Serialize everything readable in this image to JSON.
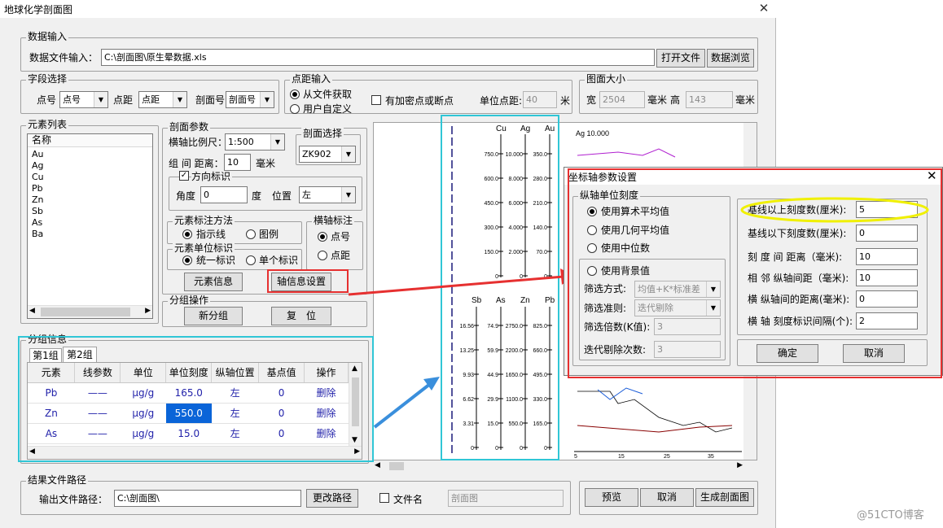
{
  "window": {
    "title": "地球化学剖面图",
    "close_glyph": "✕"
  },
  "data_input": {
    "group_title": "数据输入",
    "file_label": "数据文件输入：",
    "file_path": "C:\\剖面图\\原生晕数据.xls",
    "open_button": "打开文件",
    "browse_button": "数据浏览"
  },
  "field_select": {
    "group_title": "字段选择",
    "point_label": "点号",
    "point_value": "点号",
    "distance_label": "点距",
    "distance_value": "点距",
    "section_label": "剖面号",
    "section_value": "剖面号"
  },
  "point_distance": {
    "group_title": "点距输入",
    "from_file": "从文件获取",
    "custom": "用户自定义",
    "encrypt_label": "有加密点或断点",
    "unit_label": "单位点距:",
    "unit_value": "40",
    "unit_suffix": "米"
  },
  "map_size": {
    "group_title": "图面大小",
    "width_label": "宽",
    "width_value": "2504",
    "mm_label": "毫米",
    "height_label": "高",
    "height_value": "143",
    "mm_label2": "毫米"
  },
  "elements": {
    "group_title": "元素列表",
    "header": "名称",
    "items": [
      "Au",
      "Ag",
      "Cu",
      "Pb",
      "Zn",
      "Sb",
      "As",
      "Ba"
    ]
  },
  "section_params": {
    "group_title": "剖面参数",
    "scale_label": "横轴比例尺：",
    "scale_value": "1:500",
    "group_dist_label": "组 间 距离：",
    "group_dist_value": "10",
    "group_dist_unit": "毫米",
    "section_select_title": "剖面选择",
    "section_select_value": "ZK902",
    "direction_label": "方向标识",
    "direction_check": "✓",
    "angle_label": "角度",
    "angle_value": "0",
    "degree_label": "度",
    "position_label": "位置",
    "position_value": "左"
  },
  "element_mark": {
    "group_title": "元素标注方法",
    "opt1": "指示线",
    "opt2": "图例"
  },
  "element_unit": {
    "group_title": "元素单位标识",
    "opt1": "统一标识",
    "opt2": "单个标识"
  },
  "haxis_mark": {
    "group_title": "横轴标注",
    "opt1": "点号",
    "opt2": "点距"
  },
  "buttons": {
    "element_info": "元素信息",
    "axis_info": "轴信息设置"
  },
  "group_ops": {
    "group_title": "分组操作",
    "new_group": "新分组",
    "reset": "复　位"
  },
  "group_info": {
    "group_title": "分组信息",
    "tab1": "第1组",
    "tab2": "第2组",
    "columns": [
      "元素",
      "线参数",
      "单位",
      "单位刻度",
      "纵轴位置",
      "基点值",
      "操作"
    ],
    "rows": [
      {
        "element": "Pb",
        "line": "——",
        "unit": "μg/g",
        "scale": "165.0",
        "pos": "左",
        "base": "0",
        "op": "删除"
      },
      {
        "element": "Zn",
        "line": "——",
        "unit": "μg/g",
        "scale": "550.0",
        "pos": "左",
        "base": "0",
        "op": "删除"
      },
      {
        "element": "As",
        "line": "——",
        "unit": "μg/g",
        "scale": "15.0",
        "pos": "左",
        "base": "0",
        "op": "删除"
      }
    ]
  },
  "result_path": {
    "group_title": "结果文件路径",
    "output_label": "输出文件路径：",
    "output_value": "C:\\剖面图\\",
    "change_button": "更改路径",
    "filename_label": "文件名",
    "filename_value": "剖面图"
  },
  "bottom_buttons": {
    "preview": "预览",
    "cancel": "取消",
    "generate": "生成剖面图"
  },
  "preview_chart": {
    "top_labels": [
      "Cu",
      "Ag",
      "Au"
    ],
    "top_col1": [
      "750.0",
      "600.0",
      "450.0",
      "300.0",
      "150.0",
      "0"
    ],
    "top_col2": [
      "10.000",
      "8.000",
      "6.000",
      "4.000",
      "2.000",
      "0"
    ],
    "top_col3": [
      "350.0",
      "280.0",
      "210.0",
      "140.0",
      "70.0",
      "0"
    ],
    "bottom_labels": [
      "Sb",
      "As",
      "Zn",
      "Pb"
    ],
    "bottom_col1": [
      "16.56",
      "13.25",
      "9.93",
      "6.62",
      "3.31",
      "0"
    ],
    "bottom_col2": [
      "74.9",
      "59.9",
      "44.9",
      "29.9",
      "15.0",
      "0"
    ],
    "bottom_col3": [
      "2750.0",
      "2200.0",
      "1650.0",
      "1100.0",
      "550.0",
      "0"
    ],
    "bottom_col4": [
      "825.0",
      "660.0",
      "495.0",
      "330.0",
      "165.0",
      "0"
    ],
    "x_labels": [
      "5",
      "15",
      "25",
      "35"
    ],
    "small_label": "Ag 10.000"
  },
  "dialog": {
    "title": "坐标轴参数设置",
    "vunit_title": "纵轴单位刻度",
    "opt_arith": "使用算术平均值",
    "opt_geo": "使用几何平均值",
    "opt_median": "使用中位数",
    "opt_bg": "使用背景值",
    "filter_method_label": "筛选方式:",
    "filter_method_value": "均值+K*标准差",
    "filter_rule_label": "筛选准则:",
    "filter_rule_value": "迭代剔除",
    "filter_k_label": "筛选倍数(K值):",
    "filter_k_value": "3",
    "iter_label": "迭代剔除次数:",
    "iter_value": "3",
    "above_label": "基线以上刻度数(厘米):",
    "above_value": "5",
    "below_label": "基线以下刻度数(厘米):",
    "below_value": "0",
    "tick_dist_label": "刻 度 间 距离（毫米):",
    "tick_dist_value": "10",
    "adj_axis_label": "相 邻 纵轴间距（毫米):",
    "adj_axis_value": "10",
    "h_axis_label": "横 纵轴间的距离(毫米):",
    "h_axis_value": "0",
    "h_tick_label": "横 轴 刻度标识间隔(个):",
    "h_tick_value": "2",
    "ok": "确定",
    "cancel": "取消"
  },
  "watermark": "@51CTO博客",
  "colors": {
    "red_highlight": "#e63030",
    "cyan_highlight": "#30c6d6",
    "blue_arrow": "#3a8fdc",
    "yellow_ellipse": "#f0f000",
    "selected_cell": "#0a64d8"
  }
}
